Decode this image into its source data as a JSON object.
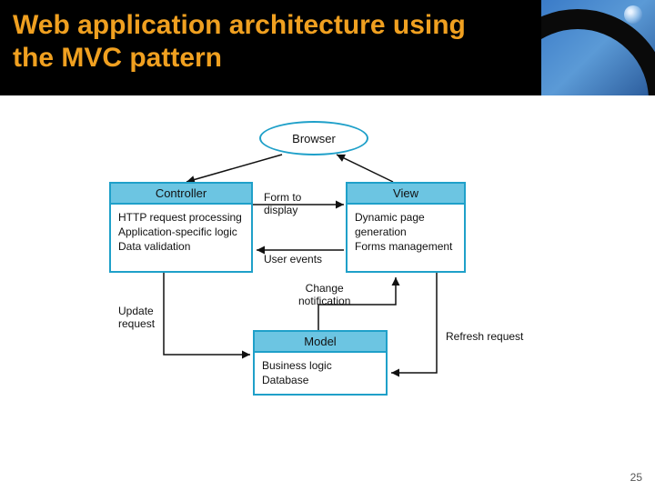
{
  "header": {
    "title": "Web application architecture using the MVC pattern"
  },
  "diagram": {
    "browser": "Browser",
    "controller": {
      "title": "Controller",
      "body": "HTTP request processing\nApplication-specific logic\nData validation"
    },
    "view": {
      "title": "View",
      "body": "Dynamic page\ngeneration\nForms management"
    },
    "model": {
      "title": "Model",
      "body": "Business logic\nDatabase"
    },
    "labels": {
      "form_to_display": "Form to\ndisplay",
      "user_events": "User events",
      "update_request": "Update\nrequest",
      "change_notification": "Change\nnotification",
      "refresh_request": "Refresh request"
    }
  },
  "page_number": "25"
}
